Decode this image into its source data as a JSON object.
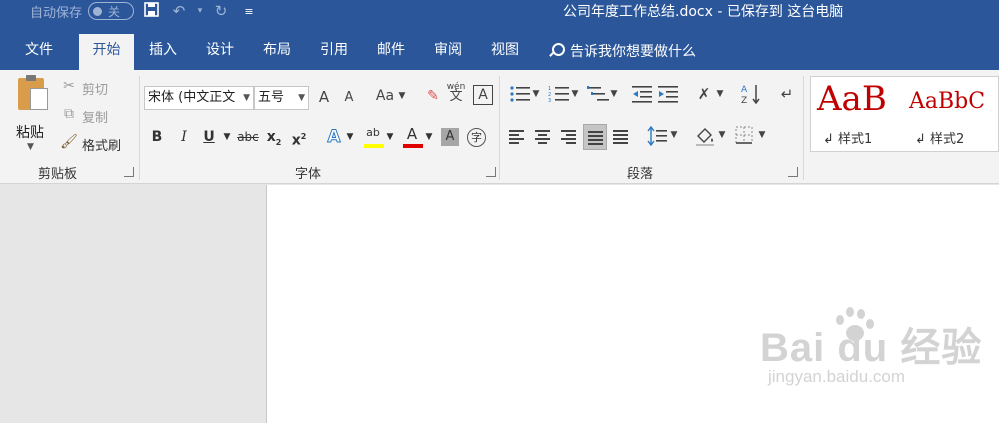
{
  "title_bar": {
    "autosave_label": "自动保存",
    "autosave_state": "关",
    "document_title": "公司年度工作总结.docx - 已保存到 这台电脑"
  },
  "tabs": [
    {
      "label": "文件"
    },
    {
      "label": "开始"
    },
    {
      "label": "插入"
    },
    {
      "label": "设计"
    },
    {
      "label": "布局"
    },
    {
      "label": "引用"
    },
    {
      "label": "邮件"
    },
    {
      "label": "审阅"
    },
    {
      "label": "视图"
    }
  ],
  "active_tab": "开始",
  "tell_me": {
    "placeholder": "告诉我你想要做什么"
  },
  "clipboard": {
    "group_label": "剪贴板",
    "paste": "粘贴",
    "cut": "剪切",
    "copy": "复制",
    "format_painter": "格式刷"
  },
  "font": {
    "group_label": "字体",
    "font_name": "宋体 (中文正文",
    "font_size": "五号",
    "grow": "A",
    "shrink": "A",
    "change_case": "Aa",
    "phonetic_top": "wén",
    "phonetic_bottom": "文",
    "char_border": "A",
    "bold": "B",
    "italic": "I",
    "underline": "U",
    "strikethrough": "abc",
    "subscript": "x",
    "superscript": "x",
    "text_effects": "A",
    "highlight": "ab",
    "font_color": "A",
    "char_shading": "A",
    "enclose": "字",
    "highlight_color": "#ffff00",
    "font_color_value": "#e00000"
  },
  "paragraph": {
    "group_label": "段落"
  },
  "styles": {
    "items": [
      {
        "sample": "AaB",
        "name": "样式1"
      },
      {
        "sample": "AaBbC",
        "name": "样式2"
      }
    ],
    "color": "#c00000"
  },
  "watermark": {
    "main": "Bai du 经验",
    "sub": "jingyan.baidu.com"
  },
  "colors": {
    "title_bar": "#2b579a",
    "ribbon": "#f3f3f3",
    "workspace": "#e6e6e6",
    "page": "#ffffff"
  }
}
